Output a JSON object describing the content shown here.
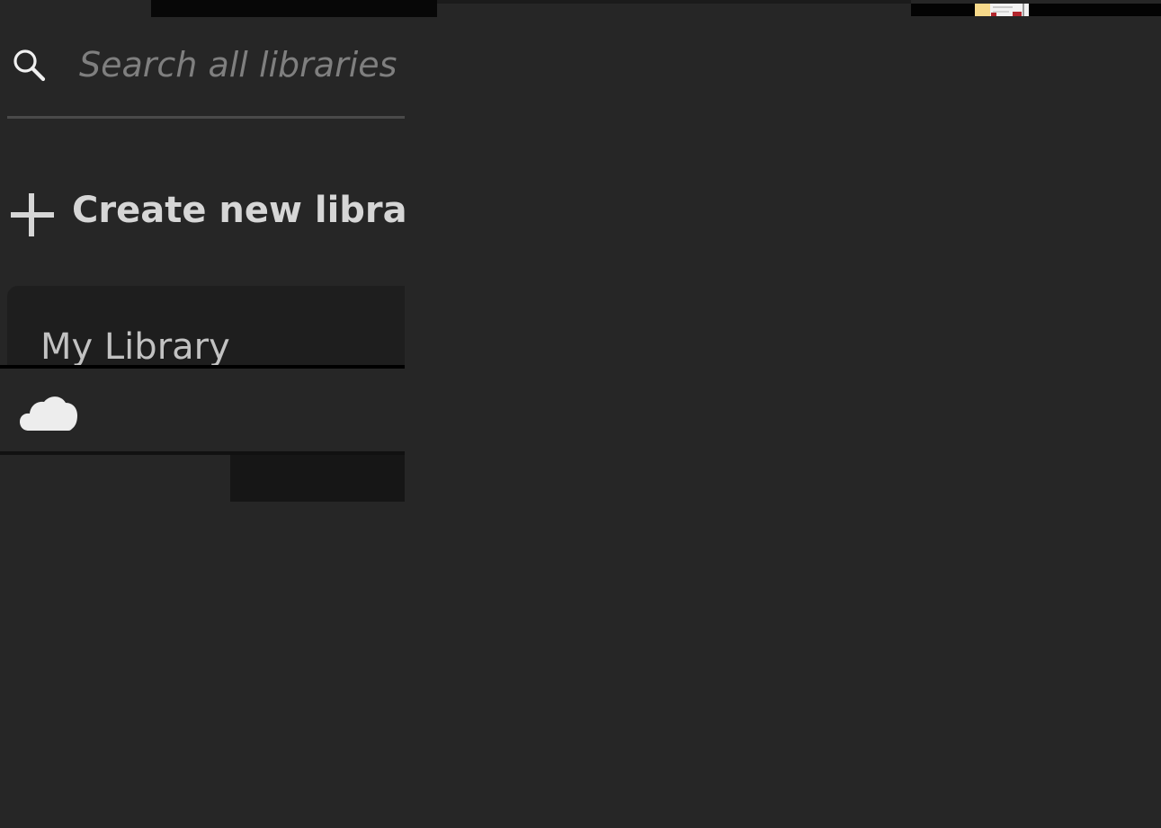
{
  "search": {
    "placeholder": "Search all libraries",
    "value": ""
  },
  "actions": {
    "create_label": "Create new library"
  },
  "libraries": [
    {
      "name": "My Library"
    }
  ],
  "icons": {
    "search": "search-icon",
    "plus": "plus-icon",
    "cloud": "cloud-icon"
  },
  "colors": {
    "background": "#262626",
    "card": "#1e1e1e",
    "text_primary": "#d6d6d6",
    "text_placeholder": "#7f7f7f",
    "divider": "#000000"
  }
}
